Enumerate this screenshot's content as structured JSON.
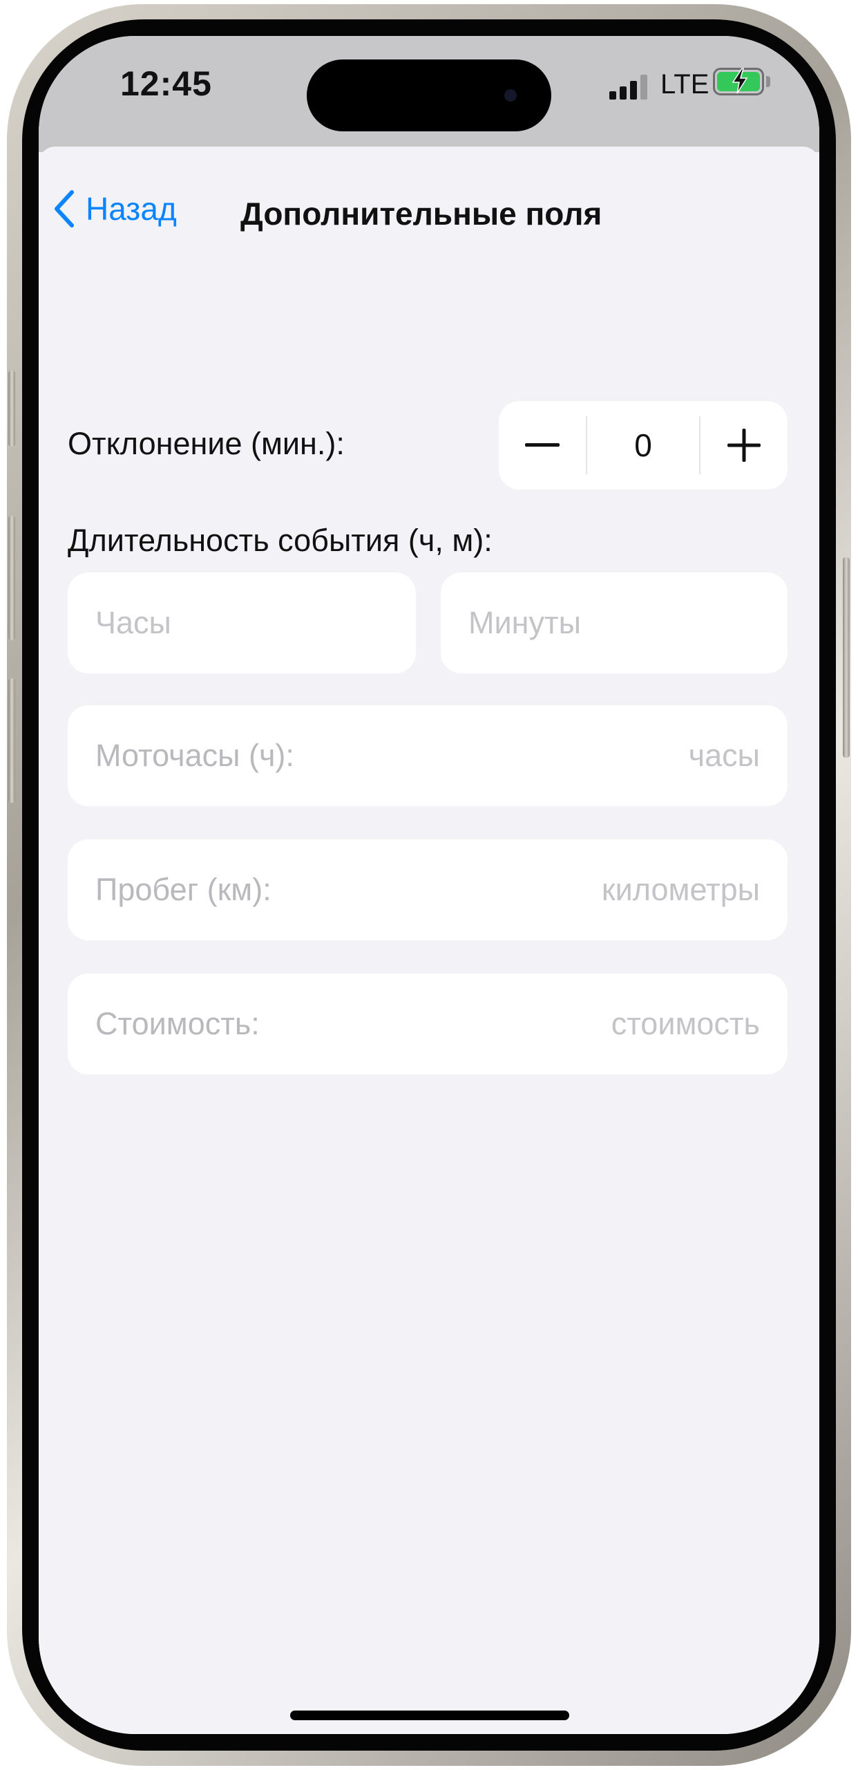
{
  "status_bar": {
    "time": "12:45",
    "network": "LTE",
    "battery_level": 1.0,
    "battery_charging": true,
    "battery_color": "#34c759"
  },
  "nav": {
    "back_label": "Назад",
    "back_icon": "chevron-left-icon",
    "title": "Дополнительные поля",
    "accent_color": "#0a84ff"
  },
  "deviation": {
    "label": "Отклонение (мин.):",
    "value": "0",
    "minus_icon": "minus-icon",
    "plus_icon": "plus-icon"
  },
  "duration": {
    "label": "Длительность события (ч, м):",
    "hours_placeholder": "Часы",
    "minutes_placeholder": "Минуты"
  },
  "engine_hours": {
    "label": "Моточасы (ч):",
    "placeholder": "часы"
  },
  "mileage": {
    "label": "Пробег (км):",
    "placeholder": "километры"
  },
  "cost": {
    "label": "Стоимость:",
    "placeholder": "стоимость"
  }
}
